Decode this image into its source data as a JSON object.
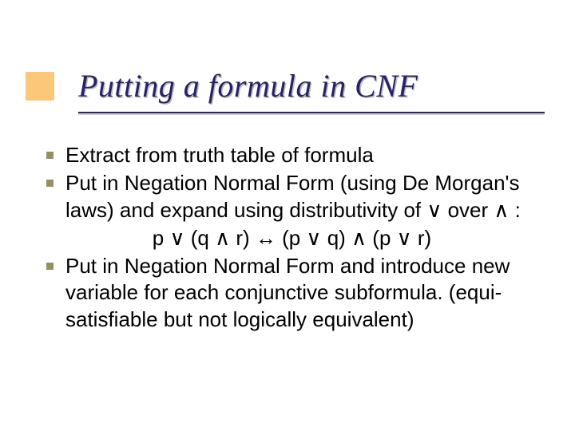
{
  "title": "Putting a formula in CNF",
  "bullets": [
    {
      "text": "Extract from truth table of formula"
    },
    {
      "text": "Put in Negation Normal Form (using De Morgan's laws) and expand using distributivity of ∨ over ∧ :",
      "formula": "p ∨ (q ∧ r) ↔ (p ∨ q) ∧ (p ∨ r)"
    },
    {
      "text": "Put in Negation Normal Form and introduce new variable for each conjunctive subformula. (equi-satisfiable but not logically equivalent)"
    }
  ]
}
